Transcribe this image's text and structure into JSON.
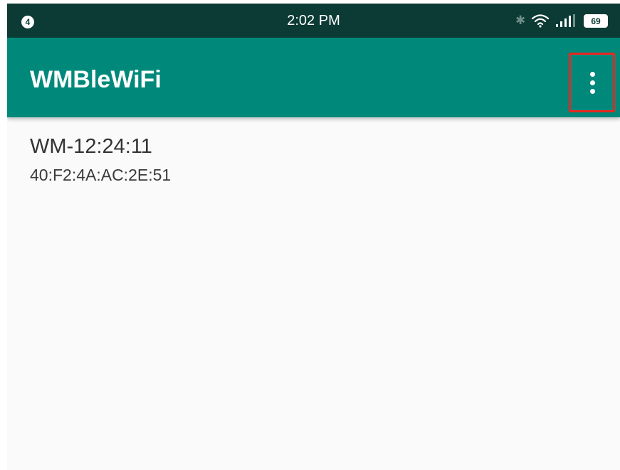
{
  "status_bar": {
    "notification_count": "4",
    "time": "2:02 PM",
    "icons": [
      "bluetooth-icon",
      "wifi-icon",
      "signal-icon",
      "battery-icon"
    ],
    "battery_level": "69",
    "background_color": "#0c3a34"
  },
  "app_bar": {
    "title": "WMBleWiFi",
    "menu_icon": "more-vert-icon",
    "background_color": "#00897b",
    "highlight_color": "#e8251f"
  },
  "devices": [
    {
      "name": "WM-12:24:11",
      "address": "40:F2:4A:AC:2E:51"
    }
  ]
}
